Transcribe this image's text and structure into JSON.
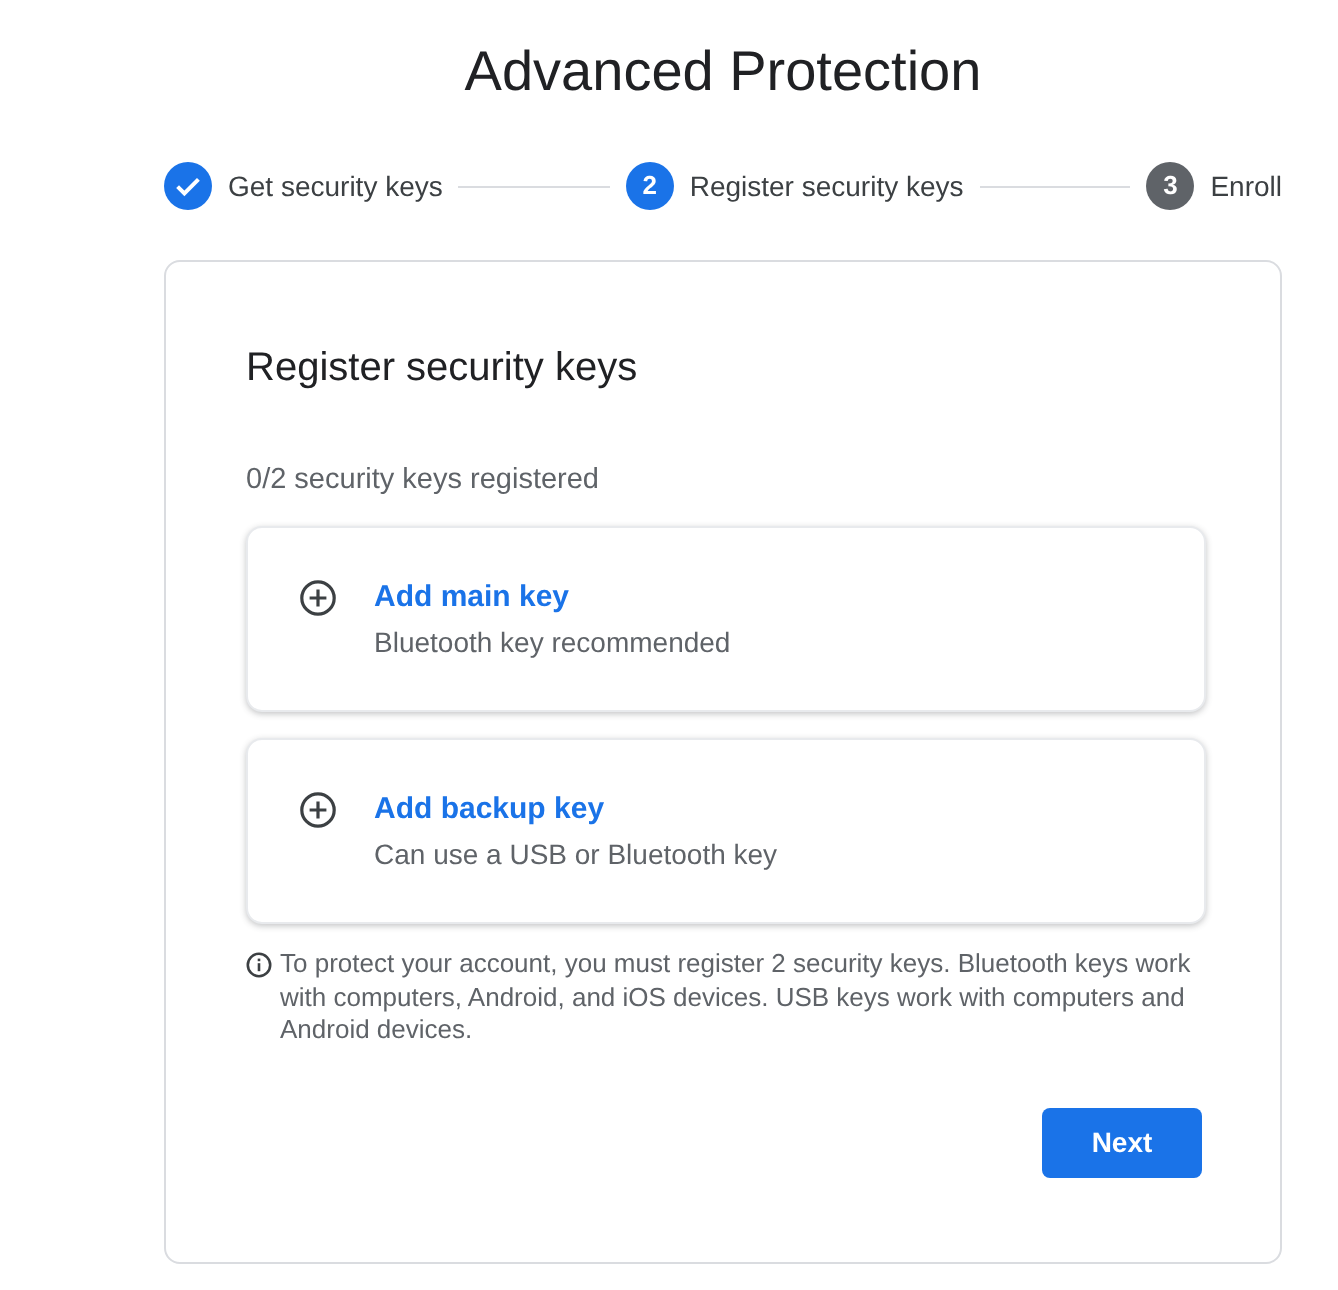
{
  "title": "Advanced Protection",
  "steps": [
    {
      "label": "Get security keys",
      "completed": true,
      "selected": false
    },
    {
      "number": "2",
      "label": "Register security keys",
      "completed": false,
      "selected": true
    },
    {
      "number": "3",
      "label": "Enroll",
      "completed": false,
      "selected": false
    }
  ],
  "card": {
    "heading": "Register security keys",
    "progress": "0/2 security keys registered",
    "keys": [
      {
        "title": "Add main key",
        "subtitle": "Bluetooth key recommended"
      },
      {
        "title": "Add backup key",
        "subtitle": "Can use a USB or Bluetooth key"
      }
    ],
    "note": "To protect your account, you must register 2 security keys. Bluetooth keys work with computers, Android, and iOS devices. USB keys work with computers and Android devices.",
    "next_button": "Next"
  }
}
